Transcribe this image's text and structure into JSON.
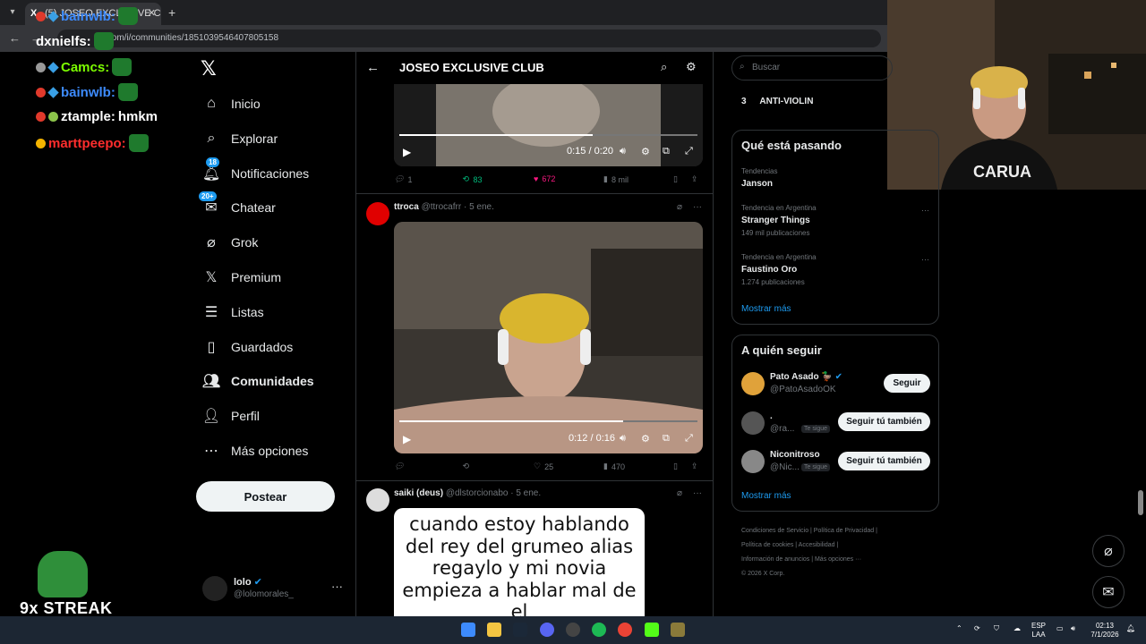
{
  "browser": {
    "tab_title": "(5) JOSEO EXCLUSIVE CL...",
    "url": "x.com/i/communities/1851039546407805158"
  },
  "overlay": {
    "chat": [
      {
        "user": "bainwlb:",
        "message": ""
      },
      {
        "user": "dxnielfs:",
        "message": ""
      },
      {
        "user": "Camcs:",
        "message": ""
      },
      {
        "user": "bainwlb:",
        "message": ""
      },
      {
        "user": "ztample:",
        "message": "hmkm"
      },
      {
        "user": "marttpeepo:",
        "message": ""
      }
    ],
    "streak": "9x STREAK"
  },
  "nav": {
    "items": [
      {
        "label": "Inicio",
        "badge": ""
      },
      {
        "label": "Explorar",
        "badge": ""
      },
      {
        "label": "Notificaciones",
        "badge": "18"
      },
      {
        "label": "Chatear",
        "badge": "20+"
      },
      {
        "label": "Grok",
        "badge": ""
      },
      {
        "label": "Premium",
        "badge": ""
      },
      {
        "label": "Listas",
        "badge": ""
      },
      {
        "label": "Guardados",
        "badge": ""
      },
      {
        "label": "Comunidades",
        "badge": ""
      },
      {
        "label": "Perfil",
        "badge": ""
      },
      {
        "label": "Más opciones",
        "badge": ""
      }
    ],
    "post_button": "Postear",
    "account": {
      "name": "lolo",
      "handle": "@lolomorales_"
    }
  },
  "community": {
    "title": "JOSEO EXCLUSIVE CLUB"
  },
  "posts": [
    {
      "video_time": "0:15 / 0:20",
      "progress": 0.65,
      "replies": "1",
      "reposts": "83",
      "likes": "672",
      "views": "8 mil"
    },
    {
      "name": "ttroca",
      "handle": "@ttrocafrr",
      "date": "· 5 ene.",
      "video_time": "0:12 / 0:16",
      "progress": 0.75,
      "replies": "",
      "reposts": "",
      "likes": "25",
      "views": "470"
    },
    {
      "name": "saiki (deus)",
      "handle": "@dlstorcionabo",
      "date": "· 5 ene.",
      "meme_text": "cuando estoy hablando del rey del grumeo alias regaylo y mi novia empieza a hablar mal de el"
    }
  ],
  "right": {
    "search_placeholder": "Buscar",
    "community_rank": {
      "num": "3",
      "name": "ANTI-VIOLIN"
    },
    "trends": {
      "title": "Qué está pasando",
      "items": [
        {
          "category": "Tendencias",
          "name": "Janson",
          "count": ""
        },
        {
          "category": "Tendencia en Argentina",
          "name": "Stranger Things",
          "count": "149 mil publicaciones"
        },
        {
          "category": "Tendencia en Argentina",
          "name": "Faustino Oro",
          "count": "1.274 publicaciones"
        }
      ],
      "more": "Mostrar más"
    },
    "follow": {
      "title": "A quién seguir",
      "items": [
        {
          "name": "Pato Asado 🦆",
          "handle": "@PatoAsadoOK",
          "button": "Seguir",
          "follows_you": ""
        },
        {
          "name": ".",
          "handle": "@ra...",
          "button": "Seguir tú también",
          "follows_you": "Te sigue"
        },
        {
          "name": "Niconitroso",
          "handle": "@Nic...",
          "button": "Seguir tú también",
          "follows_you": "Te sigue"
        }
      ],
      "more": "Mostrar más"
    },
    "footer": {
      "line1": "Condiciones de Servicio  |  Política de Privacidad  |",
      "line2": "Política de cookies  |  Accesibilidad  |",
      "line3": "Información de anuncios  |  Más opciones ···",
      "line4": "© 2026 X Corp."
    }
  },
  "taskbar": {
    "lang": "ESP",
    "lang2": "LAA",
    "time": "02:13",
    "date": "7/1/2026"
  }
}
